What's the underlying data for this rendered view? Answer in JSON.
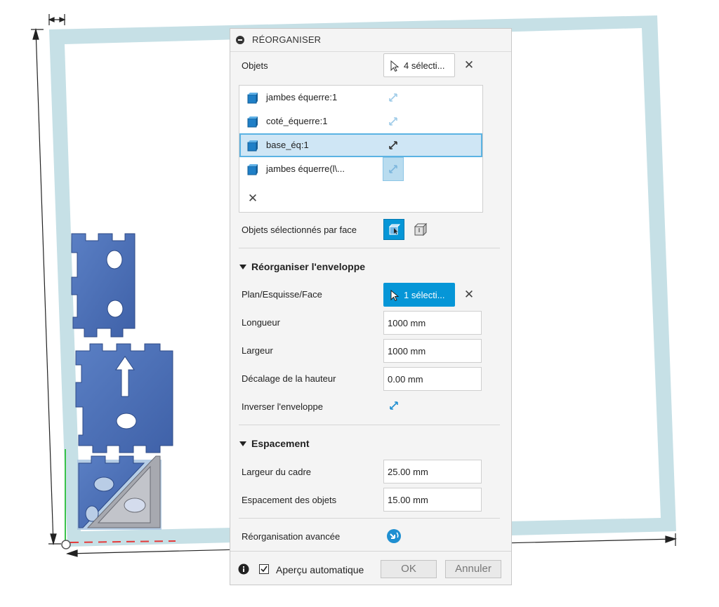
{
  "dialog": {
    "title": "RÉORGANISER",
    "objects_label": "Objets",
    "objects_selection": "4 sélecti...",
    "object_list": [
      {
        "label": "jambes équerre:1",
        "selected": false
      },
      {
        "label": "coté_équerre:1",
        "selected": false
      },
      {
        "label": "base_éq:1",
        "selected": true
      },
      {
        "label": "jambes équerre(l\\...",
        "selected": false
      }
    ],
    "face_selection_label": "Objets sélectionnés par face",
    "section_envelope": "Réorganiser l'enveloppe",
    "plane_label": "Plan/Esquisse/Face",
    "plane_selection": "1 sélecti...",
    "length_label": "Longueur",
    "length_value": "1000 mm",
    "width_label": "Largeur",
    "width_value": "1000 mm",
    "height_offset_label": "Décalage de la hauteur",
    "height_offset_value": "0.00 mm",
    "invert_label": "Inverser l'enveloppe",
    "section_spacing": "Espacement",
    "frame_width_label": "Largeur du cadre",
    "frame_width_value": "25.00 mm",
    "object_spacing_label": "Espacement des objets",
    "object_spacing_value": "15.00 mm",
    "advanced_label": "Réorganisation avancée",
    "auto_preview_label": "Aperçu automatique",
    "auto_preview_checked": true,
    "ok_label": "OK",
    "cancel_label": "Annuler"
  },
  "colors": {
    "accent": "#0696d7",
    "envelope_frame": "#c6e0e6",
    "part_blue": "#4a6fb5",
    "row_selected": "#cfe6f5"
  }
}
